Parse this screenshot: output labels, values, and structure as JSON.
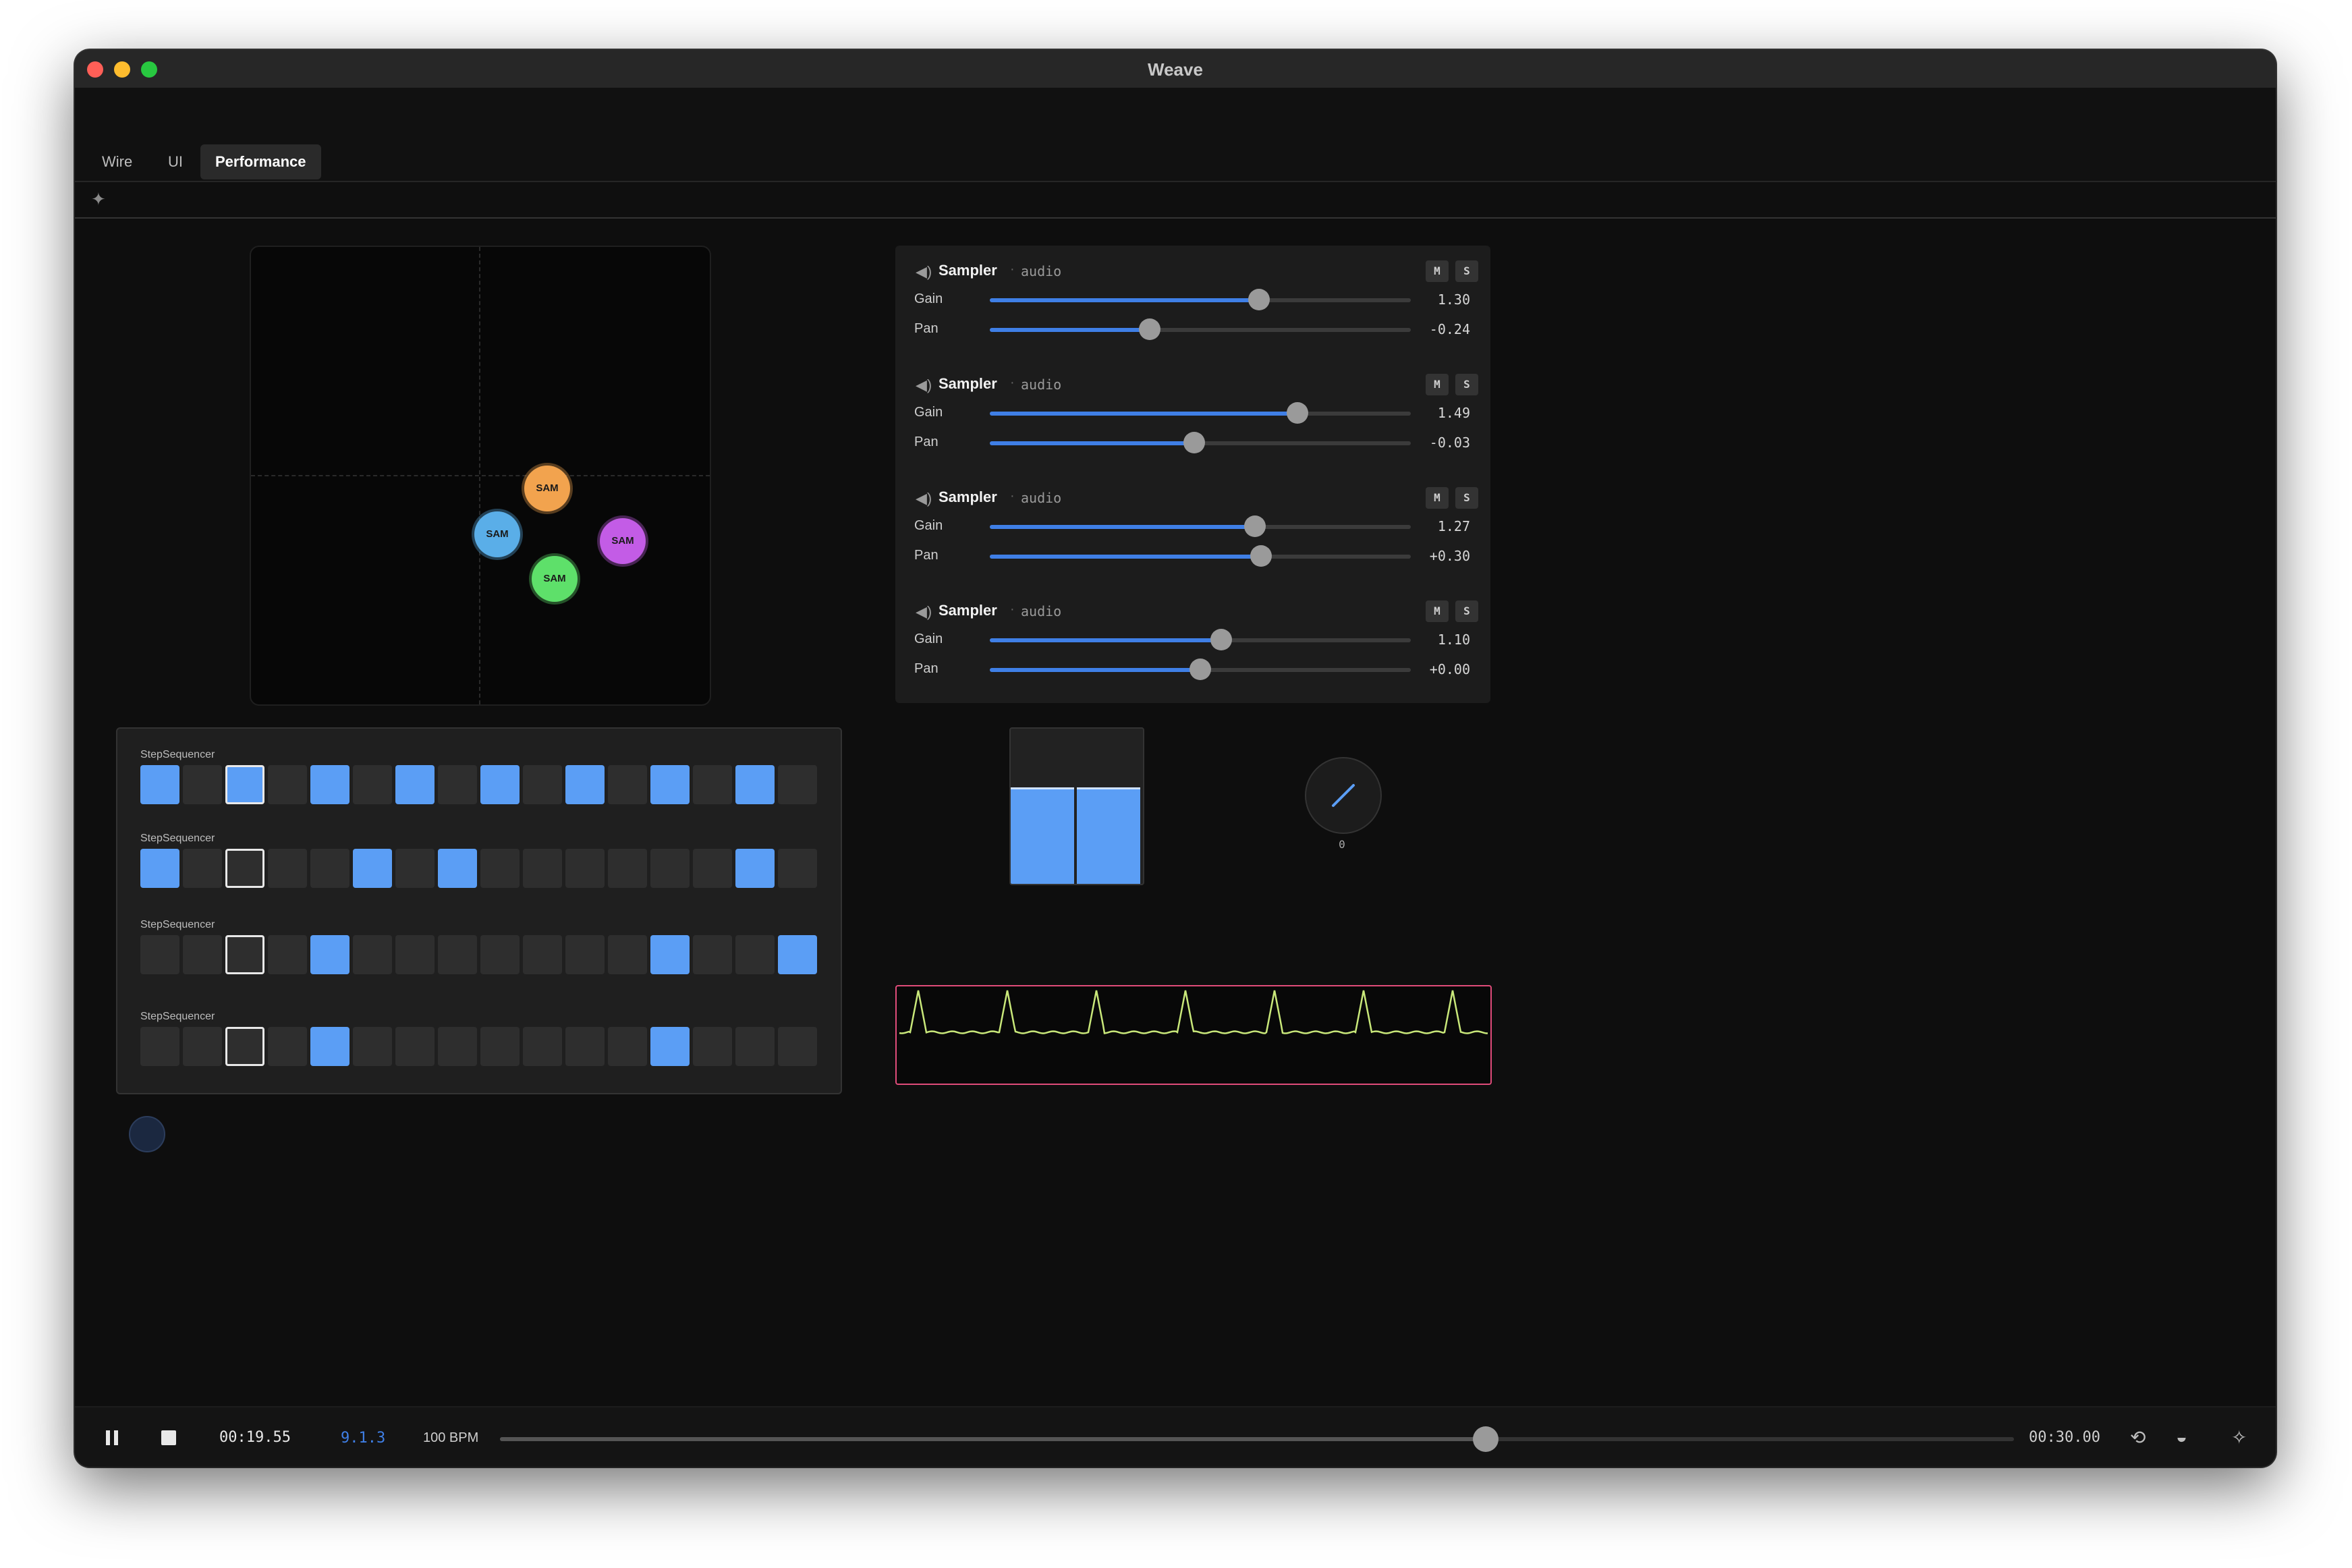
{
  "window": {
    "title": "Weave"
  },
  "tabs": [
    {
      "label": "Wire",
      "active": false
    },
    {
      "label": "UI",
      "active": false
    },
    {
      "label": "Performance",
      "active": true
    }
  ],
  "toolbar": {
    "icon": "crosshair-icon"
  },
  "xy_pad": {
    "nodes": [
      {
        "label": "SAM",
        "color": "#f2a34e"
      },
      {
        "label": "SAM",
        "color": "#5aaee8"
      },
      {
        "label": "SAM",
        "color": "#c35ce6"
      },
      {
        "label": "SAM",
        "color": "#5ee06a"
      }
    ]
  },
  "mixer": {
    "strips": [
      {
        "name": "Sampler",
        "type": "audio",
        "mute": "M",
        "solo": "S",
        "gain_label": "Gain",
        "gain_value": "1.30",
        "gain_level": 0.64,
        "pan_label": "Pan",
        "pan_value": "-0.24",
        "pan_level": 0.38
      },
      {
        "name": "Sampler",
        "type": "audio",
        "mute": "M",
        "solo": "S",
        "gain_label": "Gain",
        "gain_value": "1.49",
        "gain_level": 0.73,
        "pan_label": "Pan",
        "pan_value": "-0.03",
        "pan_level": 0.485
      },
      {
        "name": "Sampler",
        "type": "audio",
        "mute": "M",
        "solo": "S",
        "gain_label": "Gain",
        "gain_value": "1.27",
        "gain_level": 0.63,
        "pan_label": "Pan",
        "pan_value": "+0.30",
        "pan_level": 0.645
      },
      {
        "name": "Sampler",
        "type": "audio",
        "mute": "M",
        "solo": "S",
        "gain_label": "Gain",
        "gain_value": "1.10",
        "gain_level": 0.55,
        "pan_label": "Pan",
        "pan_value": "+0.00",
        "pan_level": 0.5
      }
    ],
    "accent": "#3f7fe6"
  },
  "sequencers": [
    {
      "title": "StepSequencer",
      "current_step": 2,
      "steps": [
        1,
        0,
        1,
        0,
        1,
        0,
        1,
        0,
        1,
        0,
        1,
        0,
        1,
        0,
        1,
        0
      ]
    },
    {
      "title": "StepSequencer",
      "current_step": 2,
      "steps": [
        1,
        0,
        0,
        0,
        0,
        1,
        0,
        1,
        0,
        0,
        0,
        0,
        0,
        0,
        1,
        0
      ]
    },
    {
      "title": "StepSequencer",
      "current_step": 2,
      "steps": [
        0,
        0,
        0,
        0,
        1,
        0,
        0,
        0,
        0,
        0,
        0,
        0,
        1,
        0,
        0,
        1
      ]
    },
    {
      "title": "StepSequencer",
      "current_step": 2,
      "steps": [
        0,
        0,
        0,
        0,
        1,
        0,
        0,
        0,
        0,
        0,
        0,
        0,
        1,
        0,
        0,
        0
      ]
    }
  ],
  "meter": {
    "left_level": 0.72,
    "right_level": 0.72,
    "color": "#5b9ef5"
  },
  "knob": {
    "value": "0"
  },
  "scope": {
    "border_color": "#e04c7a",
    "trace_color": "#c9e87a"
  },
  "transport": {
    "time": "00:19.55",
    "position": "9.1.3",
    "bpm": "100 BPM",
    "progress": 0.651,
    "total": "00:30.00"
  }
}
